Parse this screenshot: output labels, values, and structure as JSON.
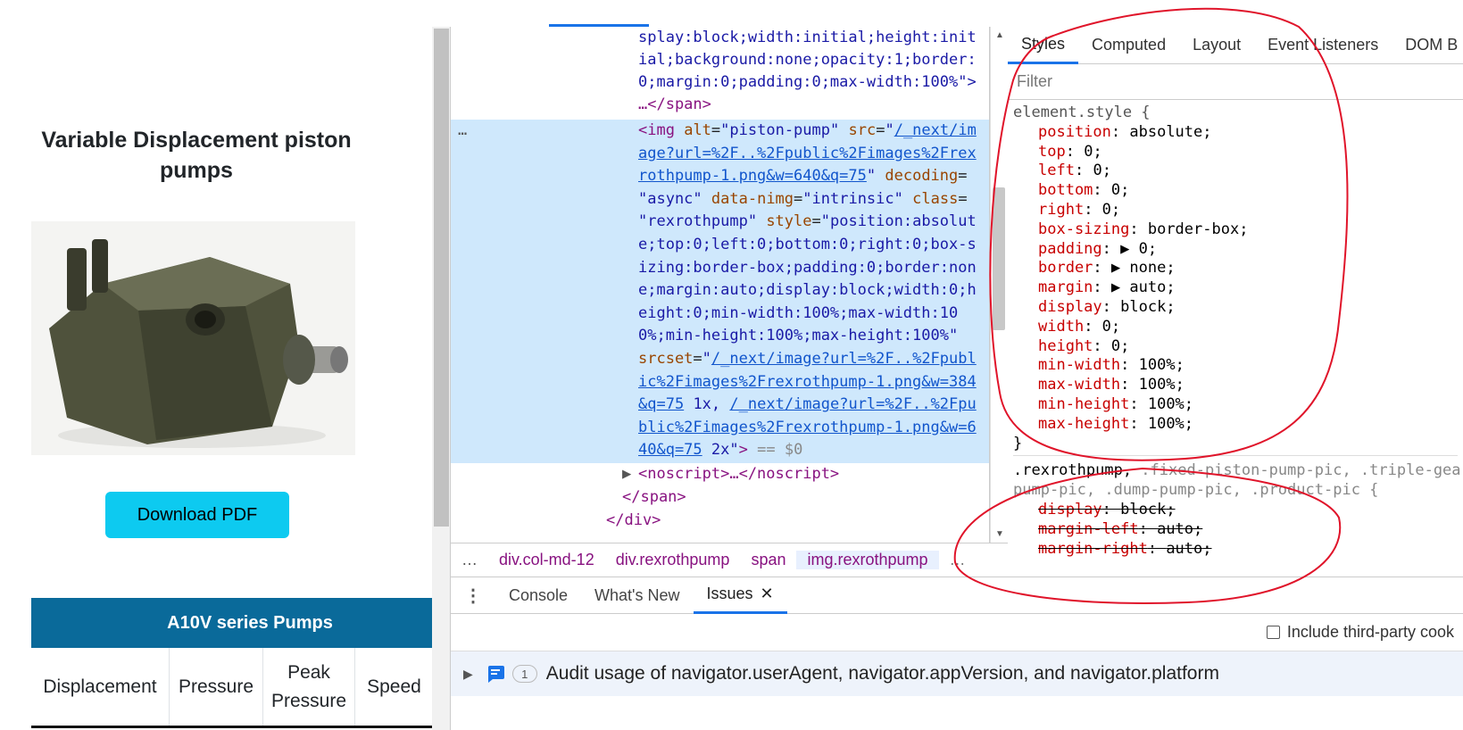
{
  "page": {
    "title": "Variable Displacement piston pumps",
    "download_label": "Download PDF",
    "table_title": "A10V series Pumps",
    "columns": [
      "Displacement",
      "Pressure",
      "Peak Pressure",
      "Speed"
    ],
    "image_alt": "piston-pump"
  },
  "devtools": {
    "elements": {
      "lines": [
        "splay:block;width:initial;height:init",
        "ial;background:none;opacity:1;border:",
        "0;margin:0;padding:0;max-width:100%\">",
        "…</span>"
      ],
      "selected_suffix": "== $0",
      "tail": [
        "<noscript>…</noscript>",
        "</span>",
        "</div>"
      ],
      "ellipsis": "…"
    },
    "breadcrumbs": [
      "div.col-md-12",
      "div.rexrothpump",
      "span",
      "img.rexrothpump"
    ],
    "breadcrumb_more": "…",
    "style_tabs": [
      "Styles",
      "Computed",
      "Layout",
      "Event Listeners",
      "DOM B"
    ],
    "filter_placeholder": "Filter",
    "element_style_selector": "element.style {",
    "element_style": [
      [
        "position",
        "absolute"
      ],
      [
        "top",
        "0"
      ],
      [
        "left",
        "0"
      ],
      [
        "bottom",
        "0"
      ],
      [
        "right",
        "0"
      ],
      [
        "box-sizing",
        "border-box"
      ],
      [
        "padding",
        "▶ 0"
      ],
      [
        "border",
        "▶ none"
      ],
      [
        "margin",
        "▶ auto"
      ],
      [
        "display",
        "block"
      ],
      [
        "width",
        "0"
      ],
      [
        "height",
        "0"
      ],
      [
        "min-width",
        "100%"
      ],
      [
        "max-width",
        "100%"
      ],
      [
        "min-height",
        "100%"
      ],
      [
        "max-height",
        "100%"
      ]
    ],
    "close_brace": "}",
    "rule2_selector_a": ".rexrothpump,",
    "rule2_selector_b": " .fixed-piston-pump-pic, .triple-gea",
    "rule2_selector_c": "pump-pic, .dump-pump-pic, .product-pic {",
    "rule2_props": [
      [
        "display",
        "block"
      ],
      [
        "margin-left",
        "auto"
      ],
      [
        "margin-right",
        "auto"
      ]
    ],
    "drawer_tabs": [
      "Console",
      "What's New",
      "Issues"
    ],
    "include_third_party": "Include third-party cook",
    "issue_count": "1",
    "issue_text": "Audit usage of navigator.userAgent, navigator.appVersion, and navigator.platform"
  },
  "colors": {
    "accent": "#1a73e8",
    "button": "#0dcaf0",
    "table_header": "#0a6a9a",
    "annotation": "#e0142a"
  }
}
